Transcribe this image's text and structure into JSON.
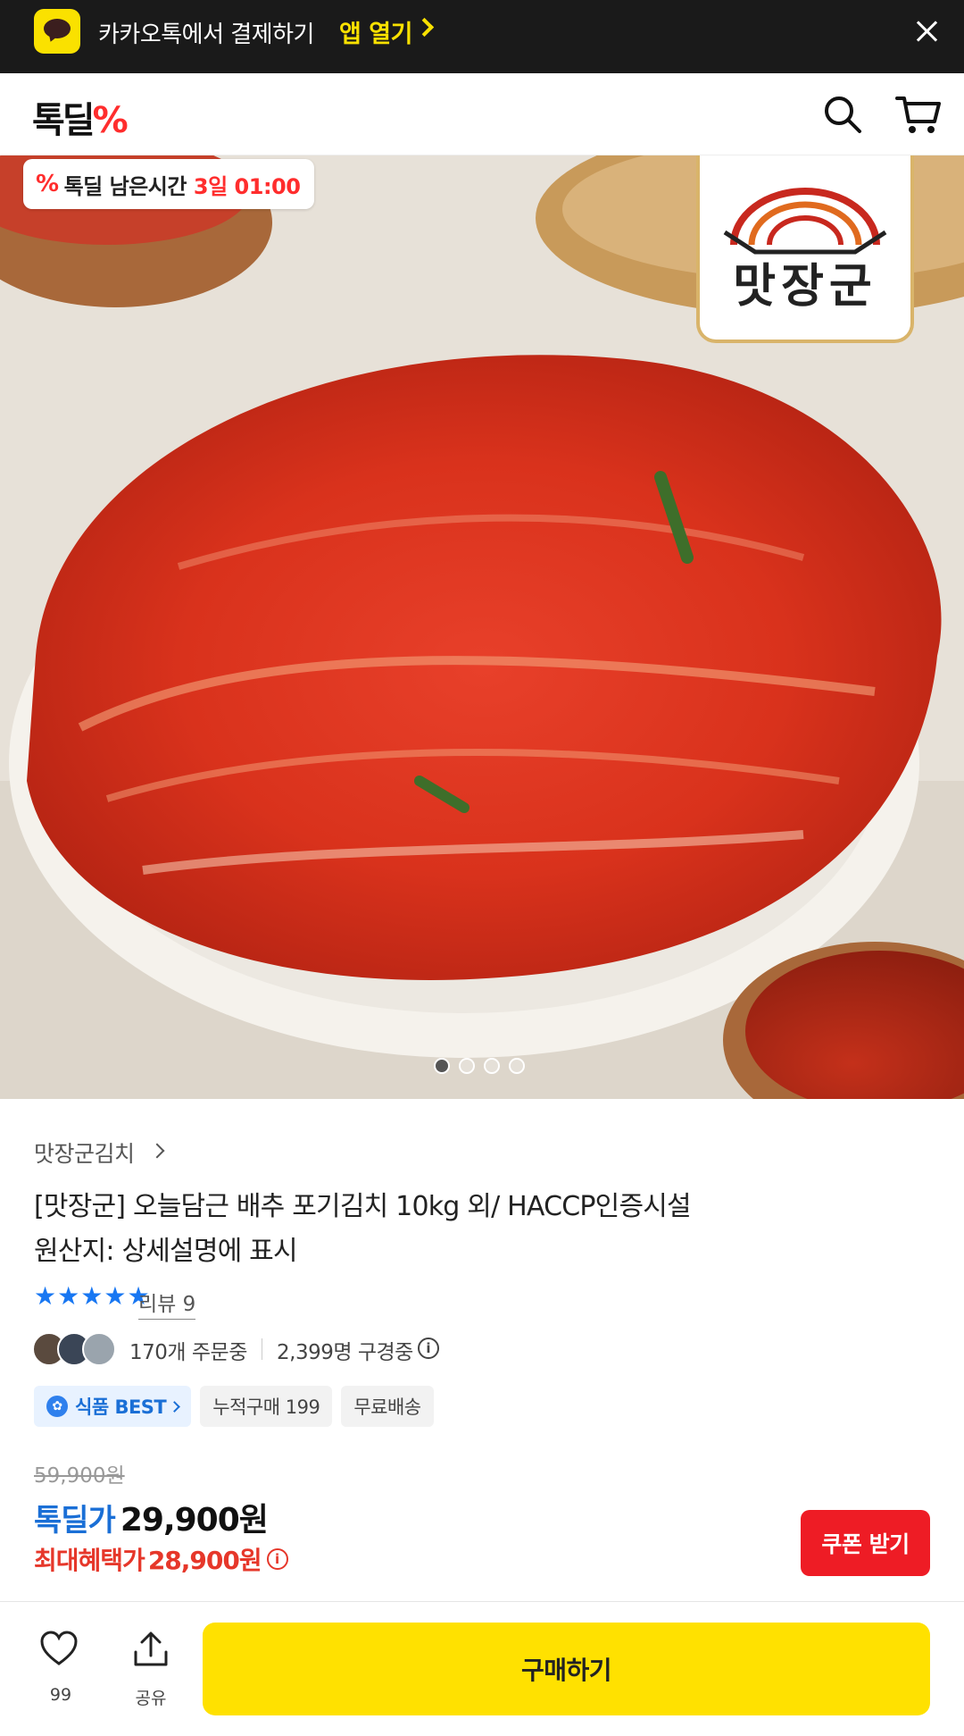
{
  "app_banner": {
    "text": "카카오톡에서 결제하기",
    "open_label": "앱 열기"
  },
  "header": {
    "logo_text": "톡딜",
    "logo_mark": "%"
  },
  "hero": {
    "timer_label": "톡딜 남은시간",
    "timer_value": "3일 01:00",
    "brand_badge": "맛장군",
    "slide_count": 4,
    "active_slide": 1
  },
  "product": {
    "brand": "맛장군김치",
    "title_line1": "[맛장군] 오늘담근 배추 포기김치 10kg 외/ HACCP인증시설",
    "title_line2": "원산지: 상세설명에 표시",
    "rating": 5,
    "review_label": "리뷰 9",
    "orders": "170개 주문중",
    "watching": "2,399명 구경중",
    "tags": [
      "식품 BEST",
      "누적구매 199",
      "무료배송"
    ]
  },
  "price": {
    "original": "59,900원",
    "deal_label": "톡딜가",
    "deal_price": "29,900원",
    "max_label": "최대혜택가",
    "max_price": "28,900원",
    "coupon_label": "쿠폰 받기"
  },
  "bottom_bar": {
    "like_count": "99",
    "share_label": "공유",
    "buy_label": "구매하기"
  },
  "colors": {
    "kakao_yellow": "#fae100",
    "deal_blue": "#1a6fd6",
    "red": "#ee1c25"
  }
}
